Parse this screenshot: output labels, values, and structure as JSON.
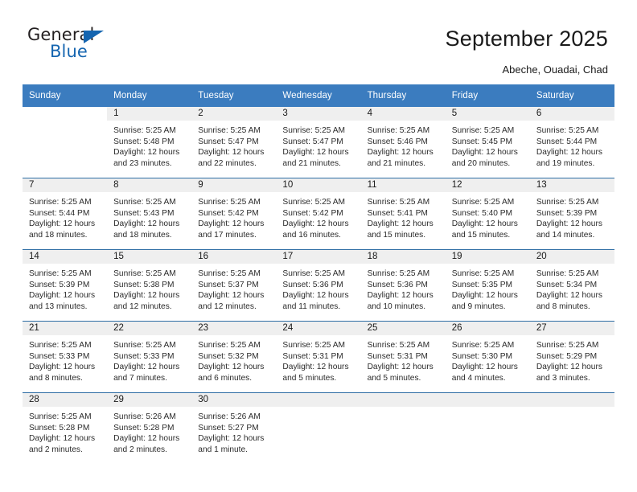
{
  "brand": {
    "name_part1": "General",
    "name_part2": "Blue",
    "accent_color": "#1565b0"
  },
  "header": {
    "title": "September 2025",
    "location": "Abeche, Ouadai, Chad"
  },
  "calendar": {
    "header_color": "#3b7cbf",
    "row_border_color": "#2e6da4",
    "daynum_band_color": "#efefef",
    "weekday_headers": [
      "Sunday",
      "Monday",
      "Tuesday",
      "Wednesday",
      "Thursday",
      "Friday",
      "Saturday"
    ],
    "weeks": [
      [
        {
          "day": "",
          "sunrise": "",
          "sunset": "",
          "daylight_line1": "",
          "daylight_line2": "",
          "blank": true
        },
        {
          "day": "1",
          "sunrise": "Sunrise: 5:25 AM",
          "sunset": "Sunset: 5:48 PM",
          "daylight_line1": "Daylight: 12 hours",
          "daylight_line2": "and 23 minutes."
        },
        {
          "day": "2",
          "sunrise": "Sunrise: 5:25 AM",
          "sunset": "Sunset: 5:47 PM",
          "daylight_line1": "Daylight: 12 hours",
          "daylight_line2": "and 22 minutes."
        },
        {
          "day": "3",
          "sunrise": "Sunrise: 5:25 AM",
          "sunset": "Sunset: 5:47 PM",
          "daylight_line1": "Daylight: 12 hours",
          "daylight_line2": "and 21 minutes."
        },
        {
          "day": "4",
          "sunrise": "Sunrise: 5:25 AM",
          "sunset": "Sunset: 5:46 PM",
          "daylight_line1": "Daylight: 12 hours",
          "daylight_line2": "and 21 minutes."
        },
        {
          "day": "5",
          "sunrise": "Sunrise: 5:25 AM",
          "sunset": "Sunset: 5:45 PM",
          "daylight_line1": "Daylight: 12 hours",
          "daylight_line2": "and 20 minutes."
        },
        {
          "day": "6",
          "sunrise": "Sunrise: 5:25 AM",
          "sunset": "Sunset: 5:44 PM",
          "daylight_line1": "Daylight: 12 hours",
          "daylight_line2": "and 19 minutes."
        }
      ],
      [
        {
          "day": "7",
          "sunrise": "Sunrise: 5:25 AM",
          "sunset": "Sunset: 5:44 PM",
          "daylight_line1": "Daylight: 12 hours",
          "daylight_line2": "and 18 minutes."
        },
        {
          "day": "8",
          "sunrise": "Sunrise: 5:25 AM",
          "sunset": "Sunset: 5:43 PM",
          "daylight_line1": "Daylight: 12 hours",
          "daylight_line2": "and 18 minutes."
        },
        {
          "day": "9",
          "sunrise": "Sunrise: 5:25 AM",
          "sunset": "Sunset: 5:42 PM",
          "daylight_line1": "Daylight: 12 hours",
          "daylight_line2": "and 17 minutes."
        },
        {
          "day": "10",
          "sunrise": "Sunrise: 5:25 AM",
          "sunset": "Sunset: 5:42 PM",
          "daylight_line1": "Daylight: 12 hours",
          "daylight_line2": "and 16 minutes."
        },
        {
          "day": "11",
          "sunrise": "Sunrise: 5:25 AM",
          "sunset": "Sunset: 5:41 PM",
          "daylight_line1": "Daylight: 12 hours",
          "daylight_line2": "and 15 minutes."
        },
        {
          "day": "12",
          "sunrise": "Sunrise: 5:25 AM",
          "sunset": "Sunset: 5:40 PM",
          "daylight_line1": "Daylight: 12 hours",
          "daylight_line2": "and 15 minutes."
        },
        {
          "day": "13",
          "sunrise": "Sunrise: 5:25 AM",
          "sunset": "Sunset: 5:39 PM",
          "daylight_line1": "Daylight: 12 hours",
          "daylight_line2": "and 14 minutes."
        }
      ],
      [
        {
          "day": "14",
          "sunrise": "Sunrise: 5:25 AM",
          "sunset": "Sunset: 5:39 PM",
          "daylight_line1": "Daylight: 12 hours",
          "daylight_line2": "and 13 minutes."
        },
        {
          "day": "15",
          "sunrise": "Sunrise: 5:25 AM",
          "sunset": "Sunset: 5:38 PM",
          "daylight_line1": "Daylight: 12 hours",
          "daylight_line2": "and 12 minutes."
        },
        {
          "day": "16",
          "sunrise": "Sunrise: 5:25 AM",
          "sunset": "Sunset: 5:37 PM",
          "daylight_line1": "Daylight: 12 hours",
          "daylight_line2": "and 12 minutes."
        },
        {
          "day": "17",
          "sunrise": "Sunrise: 5:25 AM",
          "sunset": "Sunset: 5:36 PM",
          "daylight_line1": "Daylight: 12 hours",
          "daylight_line2": "and 11 minutes."
        },
        {
          "day": "18",
          "sunrise": "Sunrise: 5:25 AM",
          "sunset": "Sunset: 5:36 PM",
          "daylight_line1": "Daylight: 12 hours",
          "daylight_line2": "and 10 minutes."
        },
        {
          "day": "19",
          "sunrise": "Sunrise: 5:25 AM",
          "sunset": "Sunset: 5:35 PM",
          "daylight_line1": "Daylight: 12 hours",
          "daylight_line2": "and 9 minutes."
        },
        {
          "day": "20",
          "sunrise": "Sunrise: 5:25 AM",
          "sunset": "Sunset: 5:34 PM",
          "daylight_line1": "Daylight: 12 hours",
          "daylight_line2": "and 8 minutes."
        }
      ],
      [
        {
          "day": "21",
          "sunrise": "Sunrise: 5:25 AM",
          "sunset": "Sunset: 5:33 PM",
          "daylight_line1": "Daylight: 12 hours",
          "daylight_line2": "and 8 minutes."
        },
        {
          "day": "22",
          "sunrise": "Sunrise: 5:25 AM",
          "sunset": "Sunset: 5:33 PM",
          "daylight_line1": "Daylight: 12 hours",
          "daylight_line2": "and 7 minutes."
        },
        {
          "day": "23",
          "sunrise": "Sunrise: 5:25 AM",
          "sunset": "Sunset: 5:32 PM",
          "daylight_line1": "Daylight: 12 hours",
          "daylight_line2": "and 6 minutes."
        },
        {
          "day": "24",
          "sunrise": "Sunrise: 5:25 AM",
          "sunset": "Sunset: 5:31 PM",
          "daylight_line1": "Daylight: 12 hours",
          "daylight_line2": "and 5 minutes."
        },
        {
          "day": "25",
          "sunrise": "Sunrise: 5:25 AM",
          "sunset": "Sunset: 5:31 PM",
          "daylight_line1": "Daylight: 12 hours",
          "daylight_line2": "and 5 minutes."
        },
        {
          "day": "26",
          "sunrise": "Sunrise: 5:25 AM",
          "sunset": "Sunset: 5:30 PM",
          "daylight_line1": "Daylight: 12 hours",
          "daylight_line2": "and 4 minutes."
        },
        {
          "day": "27",
          "sunrise": "Sunrise: 5:25 AM",
          "sunset": "Sunset: 5:29 PM",
          "daylight_line1": "Daylight: 12 hours",
          "daylight_line2": "and 3 minutes."
        }
      ],
      [
        {
          "day": "28",
          "sunrise": "Sunrise: 5:25 AM",
          "sunset": "Sunset: 5:28 PM",
          "daylight_line1": "Daylight: 12 hours",
          "daylight_line2": "and 2 minutes."
        },
        {
          "day": "29",
          "sunrise": "Sunrise: 5:26 AM",
          "sunset": "Sunset: 5:28 PM",
          "daylight_line1": "Daylight: 12 hours",
          "daylight_line2": "and 2 minutes."
        },
        {
          "day": "30",
          "sunrise": "Sunrise: 5:26 AM",
          "sunset": "Sunset: 5:27 PM",
          "daylight_line1": "Daylight: 12 hours",
          "daylight_line2": "and 1 minute."
        },
        {
          "day": "",
          "sunrise": "",
          "sunset": "",
          "daylight_line1": "",
          "daylight_line2": "",
          "empty": true
        },
        {
          "day": "",
          "sunrise": "",
          "sunset": "",
          "daylight_line1": "",
          "daylight_line2": "",
          "empty": true
        },
        {
          "day": "",
          "sunrise": "",
          "sunset": "",
          "daylight_line1": "",
          "daylight_line2": "",
          "empty": true
        },
        {
          "day": "",
          "sunrise": "",
          "sunset": "",
          "daylight_line1": "",
          "daylight_line2": "",
          "empty": true
        }
      ]
    ]
  }
}
